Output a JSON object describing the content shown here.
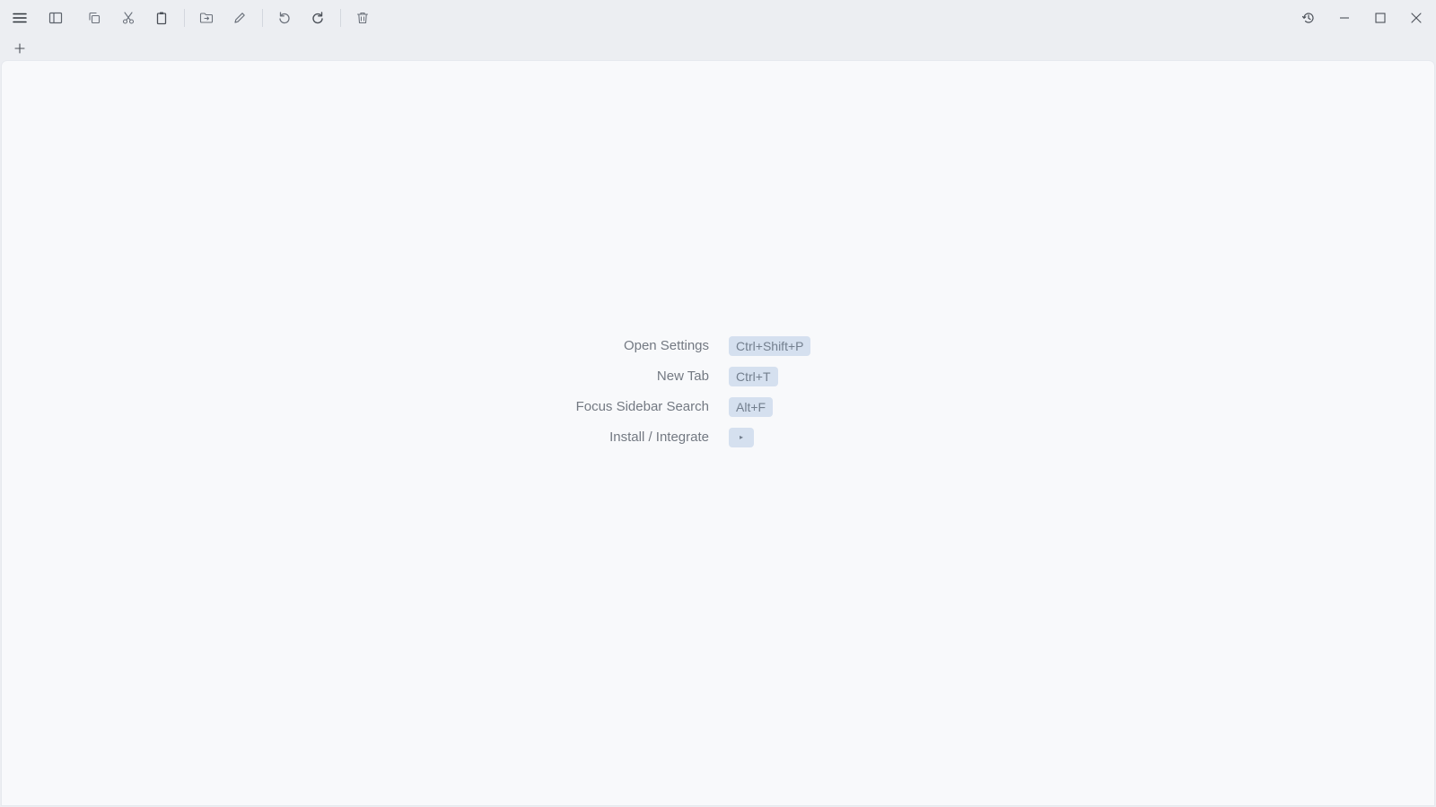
{
  "toolbar": {
    "left_buttons": [
      {
        "name": "menu-button",
        "icon": "hamburger-menu-icon"
      },
      {
        "name": "toggle-sidebar-button",
        "icon": "sidebar-icon"
      },
      {
        "name": "copy-button",
        "icon": "copy-icon"
      },
      {
        "name": "cut-button",
        "icon": "scissors-icon"
      },
      {
        "name": "paste-button",
        "icon": "clipboard-icon"
      },
      {
        "name": "move-to-folder-button",
        "icon": "folder-move-icon"
      },
      {
        "name": "rename-button",
        "icon": "pencil-icon"
      },
      {
        "name": "undo-button",
        "icon": "undo-icon"
      },
      {
        "name": "redo-button",
        "icon": "redo-icon"
      },
      {
        "name": "delete-button",
        "icon": "trash-icon"
      }
    ],
    "right_buttons": [
      {
        "name": "history-button",
        "icon": "history-icon"
      },
      {
        "name": "minimize-button",
        "icon": "minimize-icon"
      },
      {
        "name": "maximize-button",
        "icon": "maximize-icon"
      },
      {
        "name": "close-button",
        "icon": "close-icon"
      }
    ]
  },
  "tabbar": {
    "add_tab_icon": "plus-icon"
  },
  "shortcuts": [
    {
      "label": "Open Settings",
      "key": "Ctrl+Shift+P"
    },
    {
      "label": "New Tab",
      "key": "Ctrl+T"
    },
    {
      "label": "Focus Sidebar Search",
      "key": "Alt+F"
    },
    {
      "label": "Install / Integrate",
      "key": "▸"
    }
  ],
  "colors": {
    "chrome_background": "#eceef2",
    "content_background": "#f8f9fb",
    "key_badge_background": "#d5e0ef",
    "icon_color": "#6b717b",
    "label_color": "#737982"
  }
}
